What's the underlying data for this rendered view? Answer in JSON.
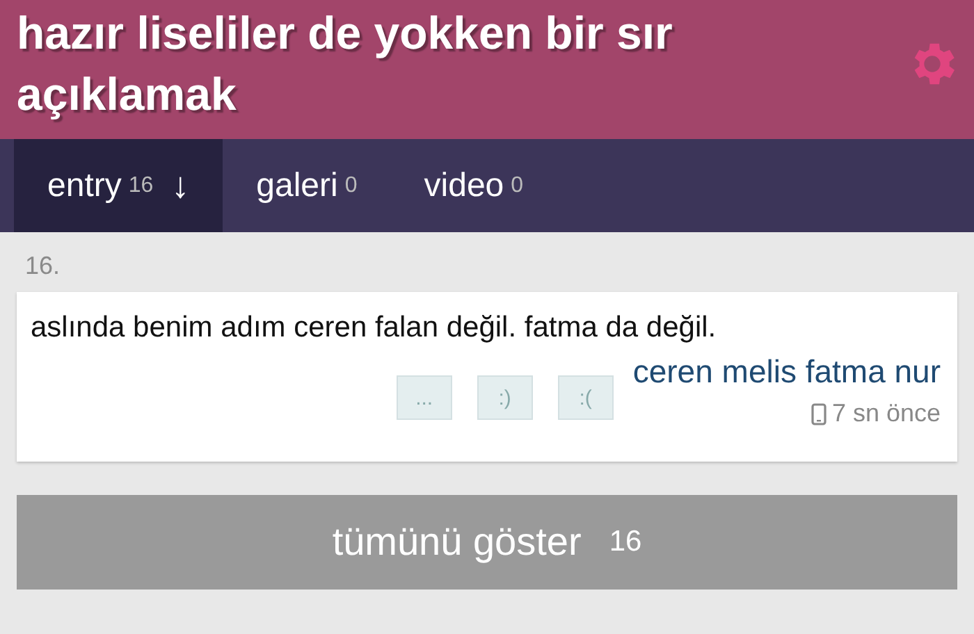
{
  "header": {
    "title": "hazır liseliler de yokken bir sır açıklamak"
  },
  "tabs": [
    {
      "label": "entry",
      "count": "16",
      "arrow": "↓",
      "selected": true
    },
    {
      "label": "galeri",
      "count": "0",
      "selected": false
    },
    {
      "label": "video",
      "count": "0",
      "selected": false
    }
  ],
  "entry": {
    "number": "16.",
    "text": "aslında benim adım ceren falan değil. fatma da değil.",
    "author": "ceren melis fatma nur",
    "time": "7 sn önce",
    "reactions": [
      "...",
      ":)",
      ":("
    ]
  },
  "show_all": {
    "label": "tümünü göster",
    "count": "16"
  }
}
